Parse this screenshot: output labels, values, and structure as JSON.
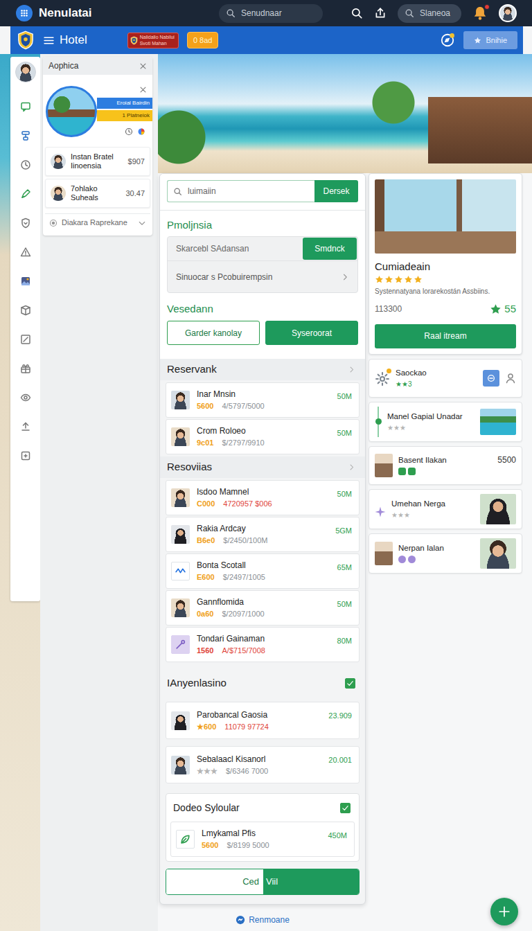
{
  "topbar": {
    "brand": "Nenulatai",
    "search": {
      "placeholder": "Senudnaar"
    },
    "quick_search": {
      "placeholder": "Slaneoa"
    },
    "notifications": {
      "unread": true
    }
  },
  "hotelbar": {
    "title": "Hotel",
    "badge": [
      "Nalidalio Nabilui",
      "Svoti Mahan"
    ],
    "count_badge": "0 8ad",
    "button": "Bnihie"
  },
  "side_panel": {
    "title": "Aophica",
    "feature": {
      "banner": [
        "Eroial Bairdin",
        "1 Platneiok"
      ]
    },
    "items": [
      {
        "name": "Instan Bratel",
        "sub": "Iinoensia",
        "value": "$907"
      },
      {
        "name": "7ohlako",
        "sub": "Suheals",
        "value": "30.47"
      }
    ],
    "dropdown": {
      "label": "Diakara Raprekane",
      "expanded": false
    }
  },
  "main": {
    "search": {
      "placeholder": "luimaiin",
      "button": "Dersek"
    },
    "filter": {
      "title": "Pmoljnsia",
      "input": {
        "placeholder": "Skarcebl SAdansan"
      },
      "button": "Smdnck",
      "option": "Sinuocar s Pcobuirempsin"
    },
    "actions": {
      "title": "Vesedann",
      "buttons": [
        {
          "label": "Garder kanolay",
          "kind": "outline"
        },
        {
          "label": "Syseroorat",
          "kind": "solid"
        }
      ]
    },
    "sections": [
      {
        "title": "Reservank",
        "kind": "header",
        "rows": [
          {
            "kind": "avatar",
            "name": "Inar Mnsin",
            "code": "5600",
            "code_color": "#f0a020",
            "detail": "4/5797/5000",
            "detail_color": "#8a8f95",
            "value": "50M"
          },
          {
            "kind": "avatar",
            "name": "Crom Roloeo",
            "code": "9c01",
            "code_color": "#f0a020",
            "detail": "$/2797/9910",
            "detail_color": "#8a8f95",
            "value": "50M"
          }
        ]
      },
      {
        "title": "Resoviias",
        "kind": "header",
        "rows": [
          {
            "kind": "avatar",
            "name": "Isdoo Mamnel",
            "code": "C000",
            "code_color": "#f0a020",
            "detail": "4720957 $006",
            "detail_color": "#e0443a",
            "value": "50M"
          },
          {
            "kind": "avatar",
            "name": "Rakia Ardcay",
            "code": "B6e0",
            "code_color": "#f0a020",
            "detail": "$/2450/100M",
            "detail_color": "#8a8f95",
            "value": "5GM"
          },
          {
            "kind": "logo",
            "name": "Bonta Scotall",
            "code": "E600",
            "code_color": "#f0a020",
            "detail": "$/2497/1005",
            "detail_color": "#8a8f95",
            "value": "65M"
          },
          {
            "kind": "avatar",
            "name": "Gannflomida",
            "code": "0a60",
            "code_color": "#f0a020",
            "detail": "$/2097/1000",
            "detail_color": "#8a8f95",
            "value": "50M"
          },
          {
            "kind": "tag",
            "name": "Tondari Gainaman",
            "code": "1560",
            "code_color": "#e0443a",
            "detail": "A/$715/7008",
            "detail_color": "#e0443a",
            "value": "80M"
          }
        ]
      },
      {
        "title": "IAnyenlasino",
        "kind": "check",
        "checked": true,
        "rows": [
          {
            "kind": "avatar",
            "name": "Parobancal Gaosia",
            "code": "★600",
            "code_color": "#f0a020",
            "detail": "11079 97724",
            "detail_color": "#e0443a",
            "value": "23.909"
          },
          {
            "kind": "avatar",
            "name": "Sebalaacl Kisanorl",
            "code": "★★★",
            "code_color": "#b5b5b5",
            "detail": "$/6346 7000",
            "detail_color": "#8a8f95",
            "value": "20.001"
          }
        ]
      },
      {
        "title": "Dodeo Syloular",
        "kind": "box",
        "checked": true,
        "rows": [
          {
            "kind": "leaf",
            "name": "Lmykamal Pfis",
            "code": "5600",
            "code_color": "#f0a020",
            "detail": "$/8199 5000",
            "detail_color": "#8a8f95",
            "value": "450M"
          }
        ]
      }
    ],
    "split_button": [
      "Ced",
      "Viil"
    ]
  },
  "right": {
    "hotel": {
      "name": "Cumiadeain",
      "stars": 5,
      "description": "Systennatyana lorarekostán Assbiins.",
      "price": "113300",
      "score": "55",
      "button": "Raal itream"
    },
    "items": [
      {
        "kind": "gear",
        "name": "Saockao",
        "rating": "★★3",
        "rating_color": "#2e9e4f",
        "tail": "actions"
      },
      {
        "kind": "timeline",
        "name": "Manel Gapial Unadar",
        "rating": "★★★",
        "rating_color": "#b5b5b5",
        "tail": "pool"
      },
      {
        "kind": "room",
        "name": "Basent Ilakan",
        "value": "5500",
        "badge_color": "#2e9e4f",
        "tail": "none"
      },
      {
        "kind": "sparkle",
        "name": "Umehan Nerga",
        "rating": "★★★",
        "rating_color": "#b5b5b5",
        "tail": "portrait"
      },
      {
        "kind": "room",
        "name": "Nerpan Ialan",
        "badge_color": "#a08ad8",
        "tail": "portrait"
      }
    ]
  },
  "footer": {
    "link": "Renmoane"
  }
}
